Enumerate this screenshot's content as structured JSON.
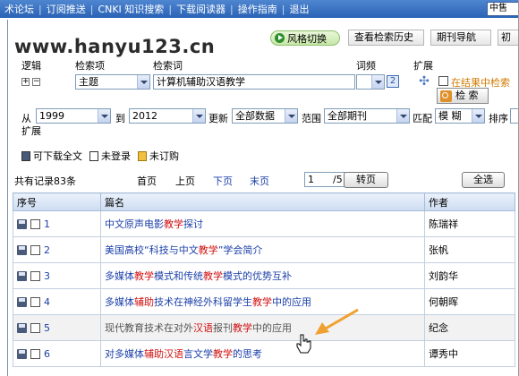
{
  "topnav": {
    "items": [
      "术论坛",
      "订阅推送",
      "CNKI 知识搜索",
      "下载阅读器",
      "操作指南",
      "退出"
    ],
    "lang": "中售"
  },
  "watermark": "www.hanyu123.cn",
  "header_buttons": {
    "style_switch": "风格切换",
    "history": "查看检索历史",
    "journal_nav": "期刊导航",
    "initial": "初"
  },
  "search": {
    "logic_label": "逻辑",
    "field_label": "检索项",
    "term_label": "检索词",
    "freq_label": "词频",
    "expand_label": "扩展",
    "field_value": "主题",
    "term_value": "计算机辅助汉语教学",
    "in_results_label": "在结果中检索",
    "search_button": "检 索",
    "from_label": "从",
    "from_year": "1999",
    "to_label": "到",
    "to_year": "2012",
    "update_label": "更新",
    "update_value": "全部数据",
    "scope_label": "范围",
    "scope_value": "全部期刊",
    "match_label": "匹配",
    "match_value": "模 糊",
    "sort_label": "排序",
    "expand2_label": "扩展"
  },
  "legend": {
    "downloadable": "可下载全文",
    "not_logged_in": "未登录",
    "not_subscribed": "未订购"
  },
  "pager": {
    "total": "共有记录83条",
    "first": "首页",
    "prev": "上页",
    "next": "下页",
    "last": "末页",
    "page_value": "1",
    "page_total": "/5",
    "go": "转页",
    "select_all": "全选"
  },
  "table": {
    "headers": [
      "序号",
      "篇名",
      "作者"
    ],
    "rows": [
      {
        "num": "1",
        "title_parts": [
          [
            "中文原声电影",
            "n"
          ],
          [
            "教学",
            "h"
          ],
          [
            "探讨",
            "n"
          ]
        ],
        "author": "陈瑞祥",
        "visited": false
      },
      {
        "num": "2",
        "title_parts": [
          [
            "美国高校“科技与中文",
            "n"
          ],
          [
            "教学",
            "h"
          ],
          [
            "”学会简介",
            "n"
          ]
        ],
        "author": "张帆",
        "visited": false
      },
      {
        "num": "3",
        "title_parts": [
          [
            "多媒体",
            "n"
          ],
          [
            "教学",
            "h"
          ],
          [
            "模式和传统",
            "n"
          ],
          [
            "教学",
            "h"
          ],
          [
            "模式的优势互补",
            "n"
          ]
        ],
        "author": "刘韵华",
        "visited": false
      },
      {
        "num": "4",
        "title_parts": [
          [
            "多媒体",
            "n"
          ],
          [
            "辅助",
            "h"
          ],
          [
            "技术在神经外科留学生",
            "n"
          ],
          [
            "教学",
            "h"
          ],
          [
            "中的应用",
            "n"
          ]
        ],
        "author": "何朝晖",
        "visited": false
      },
      {
        "num": "5",
        "title_parts": [
          [
            "现代教育技术在对外",
            "n"
          ],
          [
            "汉语",
            "h"
          ],
          [
            "报刊",
            "n"
          ],
          [
            "教学",
            "h"
          ],
          [
            "中的应用",
            "n"
          ]
        ],
        "author": "纪念",
        "visited": true
      },
      {
        "num": "6",
        "title_parts": [
          [
            "对多媒体",
            "n"
          ],
          [
            "辅助汉语",
            "h"
          ],
          [
            "言文学",
            "n"
          ],
          [
            "教学",
            "h"
          ],
          [
            "的思考",
            "n"
          ]
        ],
        "author": "谭秀中",
        "visited": false
      }
    ]
  },
  "colors": {
    "link": "#1a3fa8",
    "highlight": "#d01010",
    "nav_bar": "#2a63b6",
    "annotation_arrow": "#f0a030"
  }
}
